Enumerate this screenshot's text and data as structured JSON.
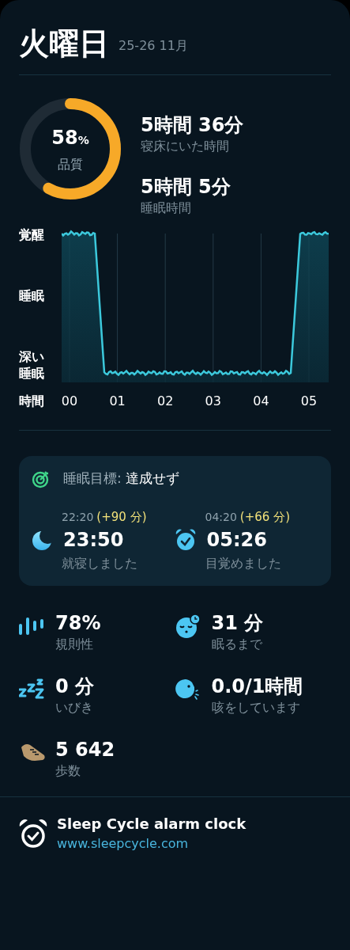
{
  "header": {
    "day": "火曜日",
    "dates": "25-26 11月"
  },
  "quality": {
    "value": "58",
    "unit": "%",
    "label": "品質"
  },
  "durations": [
    {
      "value": "5時間 36分",
      "label": "寝床にいた時間"
    },
    {
      "value": "5時間 5分",
      "label": "睡眠時間"
    }
  ],
  "graph": {
    "y_labels": [
      "覚醒",
      "睡眠",
      "深い睡眠"
    ],
    "x_axis_label": "時間",
    "x_labels": [
      "00",
      "01",
      "02",
      "03",
      "04",
      "05"
    ]
  },
  "goal": {
    "title": "睡眠目標:",
    "status": "達成せず",
    "items": [
      {
        "kind": "bedtime",
        "target": "22:20",
        "delta": "(+90 分)",
        "time": "23:50",
        "label": "就寝しました"
      },
      {
        "kind": "wakeup",
        "target": "04:20",
        "delta": "(+66 分)",
        "time": "05:26",
        "label": "目覚めました"
      }
    ]
  },
  "stats": [
    {
      "kind": "regularity",
      "value": "78%",
      "label": "規則性"
    },
    {
      "kind": "latency",
      "value": "31 分",
      "label": "眠るまで"
    },
    {
      "kind": "snore",
      "value": "0 分",
      "label": "いびき"
    },
    {
      "kind": "cough",
      "value": "0.0/1時間",
      "label": "咳をしています"
    },
    {
      "kind": "steps",
      "value": "5 642",
      "label": "歩数"
    }
  ],
  "footer": {
    "title": "Sleep Cycle alarm clock",
    "link": "www.sleepcycle.com"
  }
}
